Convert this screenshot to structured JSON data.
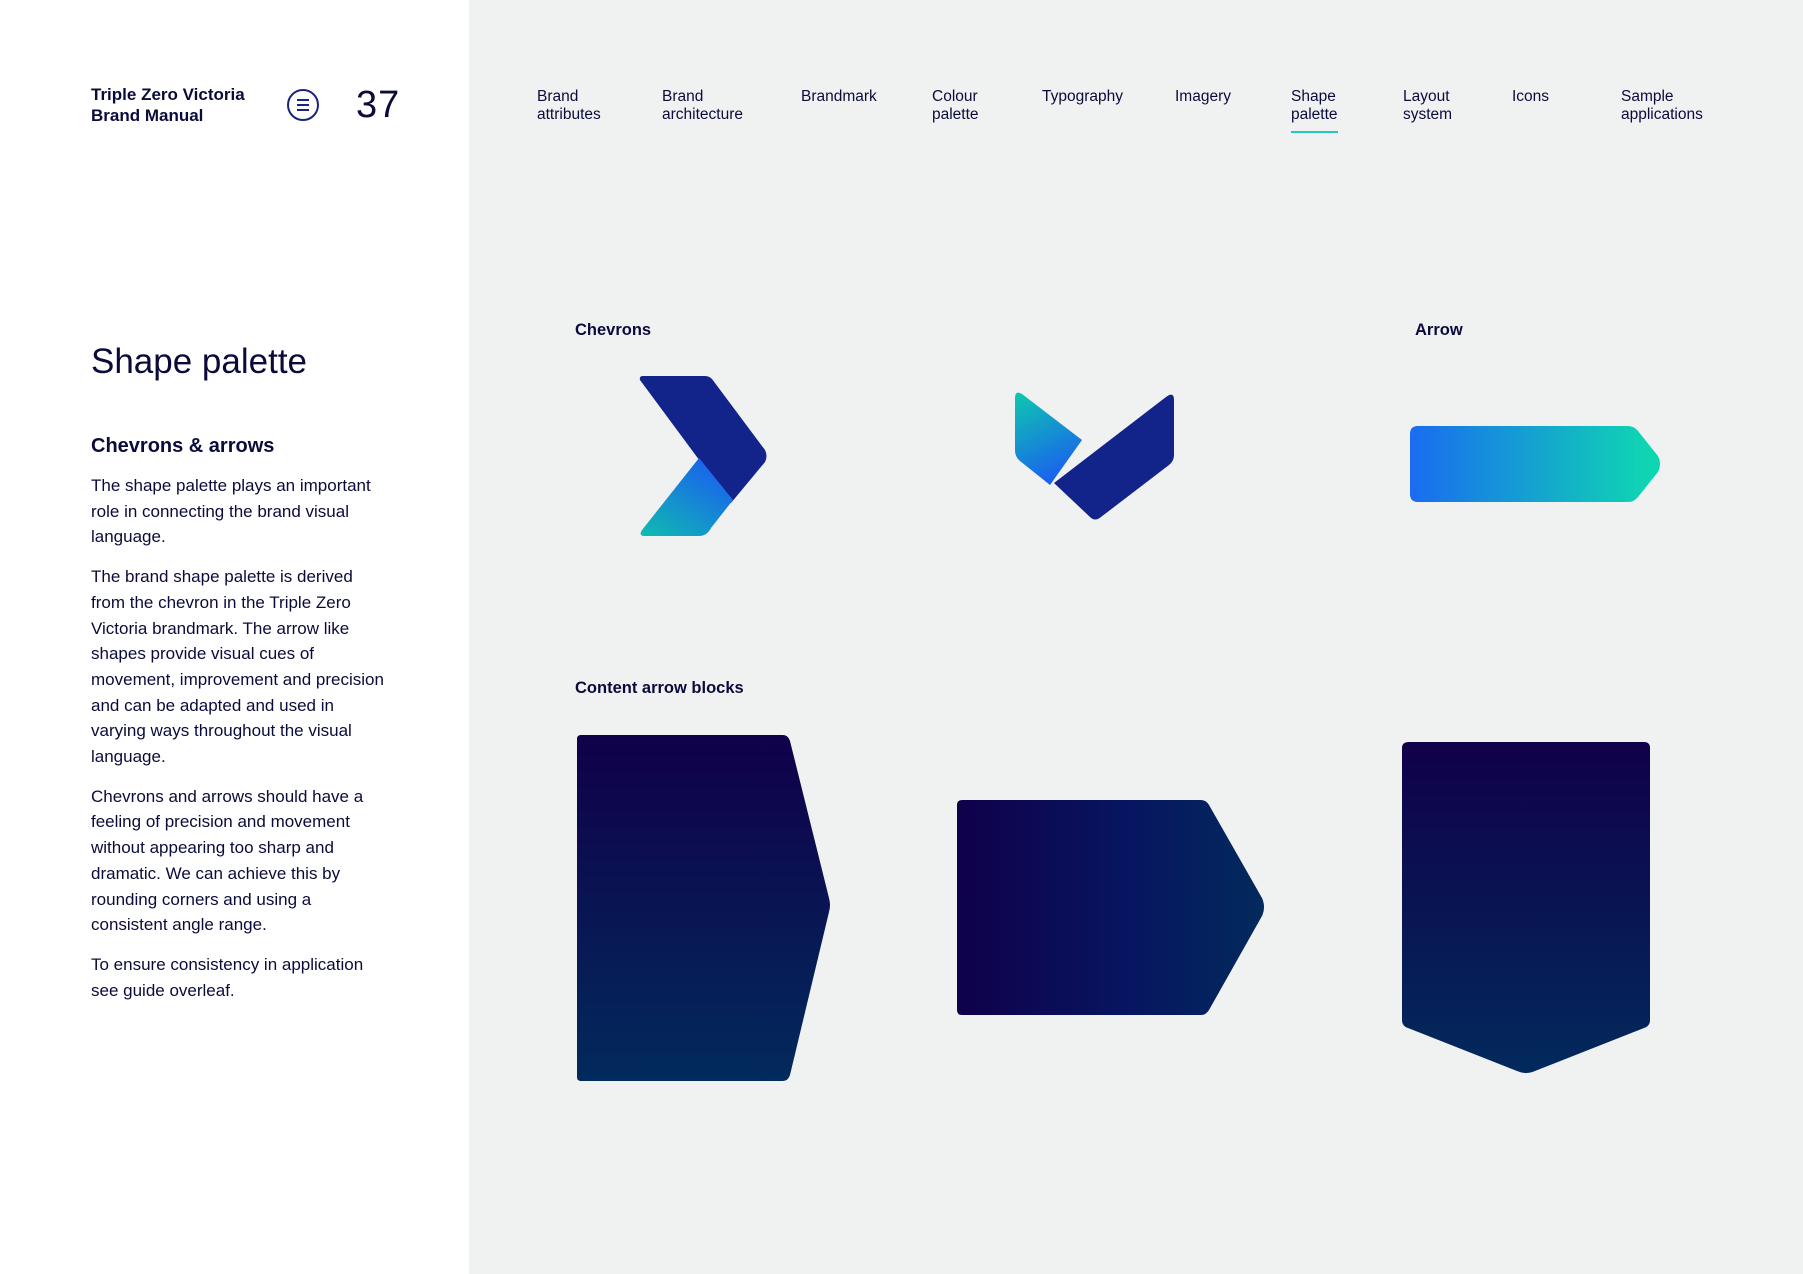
{
  "header": {
    "title_line1": "Triple Zero Victoria",
    "title_line2": "Brand Manual",
    "page_number": "37"
  },
  "nav": {
    "items": [
      {
        "label": "Brand\nattributes"
      },
      {
        "label": "Brand\narchitecture"
      },
      {
        "label": "Brandmark"
      },
      {
        "label": "Colour\npalette"
      },
      {
        "label": "Typography"
      },
      {
        "label": "Imagery"
      },
      {
        "label": "Shape\npalette"
      },
      {
        "label": "Layout\nsystem"
      },
      {
        "label": "Icons"
      },
      {
        "label": "Sample\napplications"
      }
    ],
    "active": "Shape palette"
  },
  "sidebar": {
    "page_heading": "Shape palette",
    "section_heading": "Chevrons & arrows",
    "paragraphs": [
      "The shape palette plays an important role in connecting the brand visual language.",
      "The brand shape palette is derived from the chevron in the Triple Zero Victoria brandmark. The arrow like shapes provide visual cues of movement, improvement and precision and can be adapted and used in varying ways throughout the visual language.",
      "Chevrons and arrows should have a feeling of precision and movement without appearing too sharp and dramatic. We can achieve this by rounding corners and using a consistent angle range.",
      "To ensure consistency in application see guide overleaf."
    ]
  },
  "main": {
    "chevrons_label": "Chevrons",
    "arrow_label": "Arrow",
    "content_blocks_label": "Content arrow blocks"
  },
  "colors": {
    "navy": "#0b0b3b",
    "deep_blue": "#12238a",
    "bright_blue": "#1a6cf0",
    "teal": "#0fd6b2",
    "block_top": "#10004a",
    "block_bottom": "#022a5c",
    "active_underline": "#24c6c0",
    "panel_bg": "#f0f2f2"
  }
}
